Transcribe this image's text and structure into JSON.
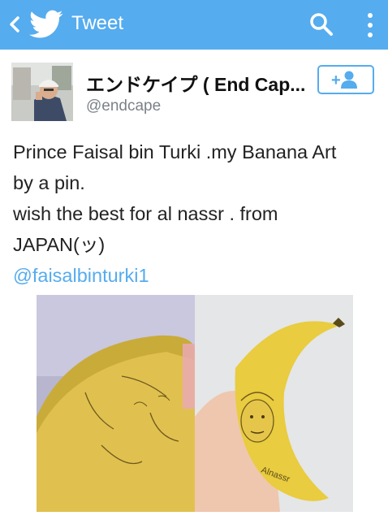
{
  "app_bar": {
    "title": "Tweet",
    "back_icon": "chevron-left-icon",
    "logo_icon": "twitter-bird-icon",
    "search_icon": "search-icon",
    "menu_icon": "more-vertical-icon",
    "color": "#55acee"
  },
  "user": {
    "display_name": "エンドケイプ ( End Cap...",
    "handle": "@endcape",
    "follow_icon": "follow-user-icon",
    "follow_label": "+"
  },
  "tweet": {
    "lines": [
      "Prince Faisal bin Turki .my Banana Art",
      "by a pin.",
      "wish the best for al nassr . from",
      "JAPAN(ッ)"
    ],
    "mention": "@faisalbinturki1"
  },
  "media": {
    "carving_text": "Alnassr"
  }
}
